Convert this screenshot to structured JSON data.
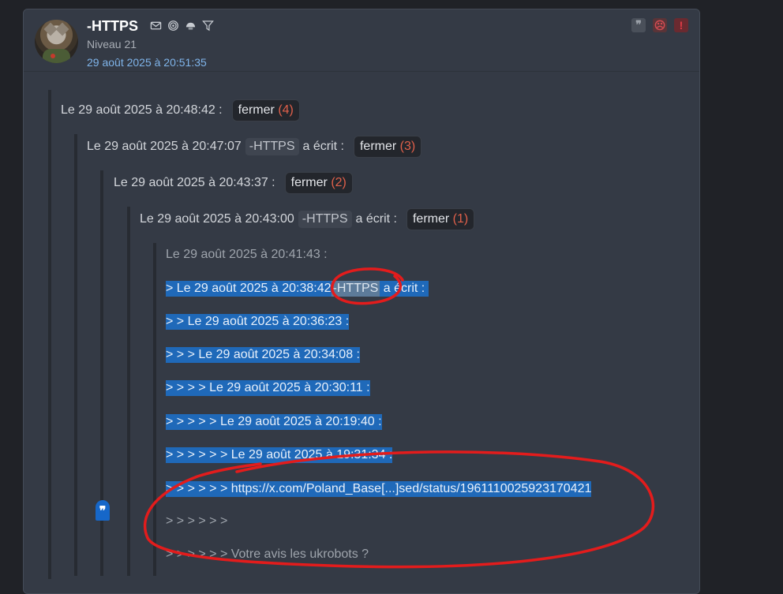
{
  "post": {
    "username": "-HTTPS",
    "level": "Niveau 21",
    "date": "29 août 2025 à 20:51:35",
    "user_icons": [
      "mail-icon",
      "spiral-icon",
      "helmet-icon",
      "filter-icon"
    ],
    "actions": {
      "quote_icon": "❞",
      "sad_icon": "☹",
      "report_icon": "!"
    }
  },
  "quotes": {
    "q1": {
      "header": "Le 29 août 2025 à 20:48:42 :",
      "button": "fermer",
      "count": "(4)"
    },
    "q2": {
      "header_pre": "Le 29 août 2025 à 20:47:07",
      "user": "-HTTPS",
      "header_post": "a écrit :",
      "button": "fermer",
      "count": "(3)"
    },
    "q3": {
      "header": "Le 29 août 2025 à 20:43:37 :",
      "button": "fermer",
      "count": "(2)"
    },
    "q4": {
      "header_pre": "Le 29 août 2025 à 20:43:00",
      "user": "-HTTPS",
      "header_post": "a écrit :",
      "button": "fermer",
      "count": "(1)"
    },
    "q5": {
      "header": "Le 29 août 2025 à 20:41:43 :",
      "line1_pre": "> Le 29 août 2025 à 20:38:4",
      "line1_gap": "2",
      "line1_user": "-HTTPS",
      "line1_post": "a écrit :",
      "line2": "> > Le 29 août 2025 à 20:36:23 :",
      "line3": "> > > Le 29 août 2025 à 20:34:08 :",
      "line4": "> > > > Le 29 août 2025 à 20:30:11 :",
      "line5": "> > > > > Le 29 août 2025 à 20:19:40 :",
      "line6": "> > > > > > Le 29 août 2025 à 19:31:34 :",
      "line7_pre": "> > > > > > https://x.com/Poland_Base",
      "line7_ellipsis": "[...]",
      "line7_post": "sed/status/1961110025923170421",
      "line8": "> > > > > >",
      "line9": "> > > > > > Votre avis les ukrobots ?"
    }
  },
  "fab_icon": "❞",
  "colors": {
    "background": "#202227",
    "card": "#343a45",
    "link": "#7fb4ea",
    "selection": "#1f69b9",
    "count": "#e0604a",
    "annotation": "#e31c1c"
  }
}
